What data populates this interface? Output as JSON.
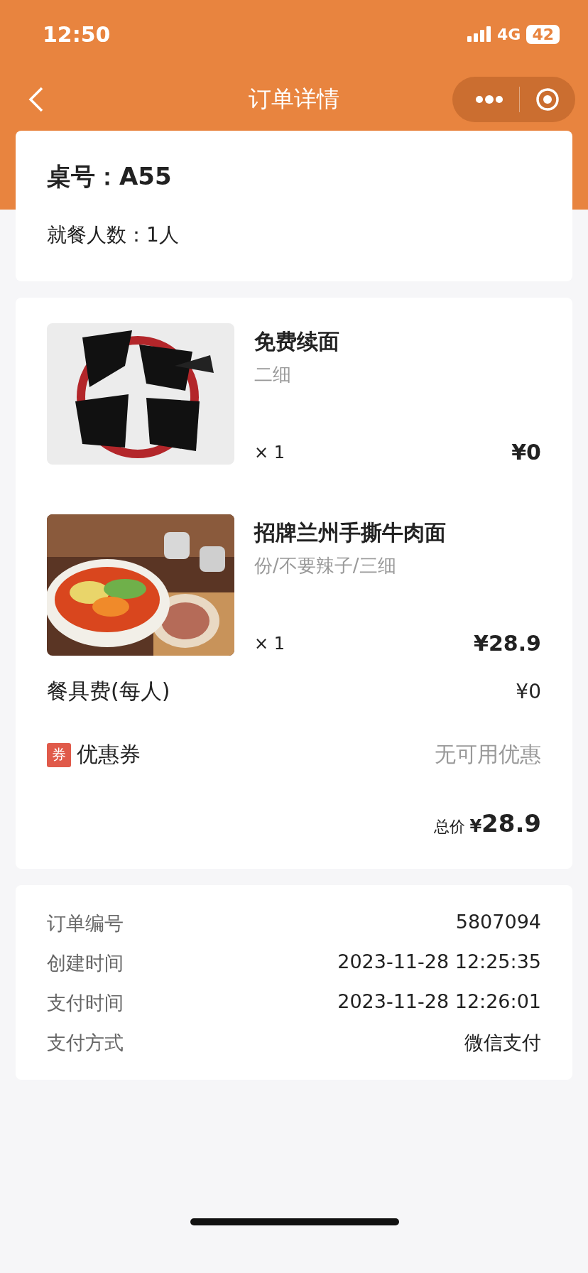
{
  "status_bar": {
    "time": "12:50",
    "network": "4G",
    "battery": "42"
  },
  "nav": {
    "title": "订单详情"
  },
  "table_info": {
    "table": "桌号：A55",
    "diners": "就餐人数：1人"
  },
  "items": [
    {
      "kind": "picture",
      "name": "免费续面",
      "spec": "二细",
      "quantity": "× 1",
      "price": "¥0"
    },
    {
      "kind": "picture",
      "name": "招牌兰州手撕牛肉面",
      "spec": "份/不要辣子/三细",
      "quantity": "× 1",
      "price": "¥28.9"
    }
  ],
  "tableware_fee": {
    "label": "餐具费(每人)",
    "value": "¥0"
  },
  "coupon": {
    "badge": "券",
    "label": "优惠券",
    "value": "无可用优惠"
  },
  "total": {
    "label": "总价",
    "currency": "¥",
    "amount": "28.9"
  },
  "order_info": [
    {
      "label": "订单编号",
      "value": "5807094"
    },
    {
      "label": "创建时间",
      "value": "2023-11-28 12:25:35"
    },
    {
      "label": "支付时间",
      "value": "2023-11-28 12:26:01"
    },
    {
      "label": "支付方式",
      "value": "微信支付"
    }
  ]
}
